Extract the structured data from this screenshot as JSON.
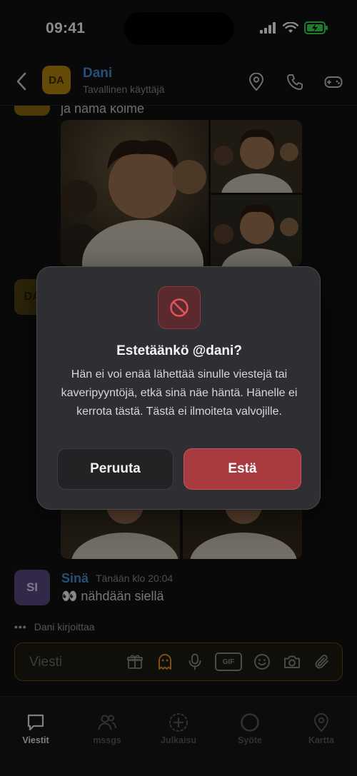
{
  "status": {
    "time": "09:41"
  },
  "header": {
    "avatar_initials": "DA",
    "name": "Dani",
    "subtitle": "Tavallinen käyttäjä"
  },
  "chat": {
    "prev_message_text": "ja nämä kolme",
    "dim_avatar_initials": "DA",
    "own_message": {
      "avatar_initials": "SI",
      "sender": "Sinä",
      "time": "Tänään klo 20:04",
      "text": "👀 nähdään siellä"
    },
    "typing_text": "Dani kirjoittaa"
  },
  "composer": {
    "placeholder": "Viesti",
    "gif_label": "GIF"
  },
  "dialog": {
    "title": "Estetäänkö @dani?",
    "body": "Hän ei voi enää lähettää sinulle viestejä tai kaveripyyntöjä, etkä sinä näe häntä. Hänelle ei kerrota tästä. Tästä ei ilmoiteta valvojille.",
    "cancel_label": "Peruuta",
    "confirm_label": "Estä"
  },
  "tabs": [
    {
      "label": "Viestit",
      "icon": "chat-bubble-icon",
      "active": true
    },
    {
      "label": "mssgs",
      "icon": "users-icon",
      "active": false
    },
    {
      "label": "Julkaisu",
      "icon": "plus-circle-icon",
      "active": false
    },
    {
      "label": "Syöte",
      "icon": "circle-icon",
      "active": false
    },
    {
      "label": "Kartta",
      "icon": "map-pin-icon",
      "active": false
    }
  ],
  "colors": {
    "accent_blue": "#4a8fd8",
    "danger": "#a83a40",
    "dani_avatar": "#b8860b",
    "own_avatar": "#5b4a82",
    "battery_green": "#3ddc56"
  }
}
